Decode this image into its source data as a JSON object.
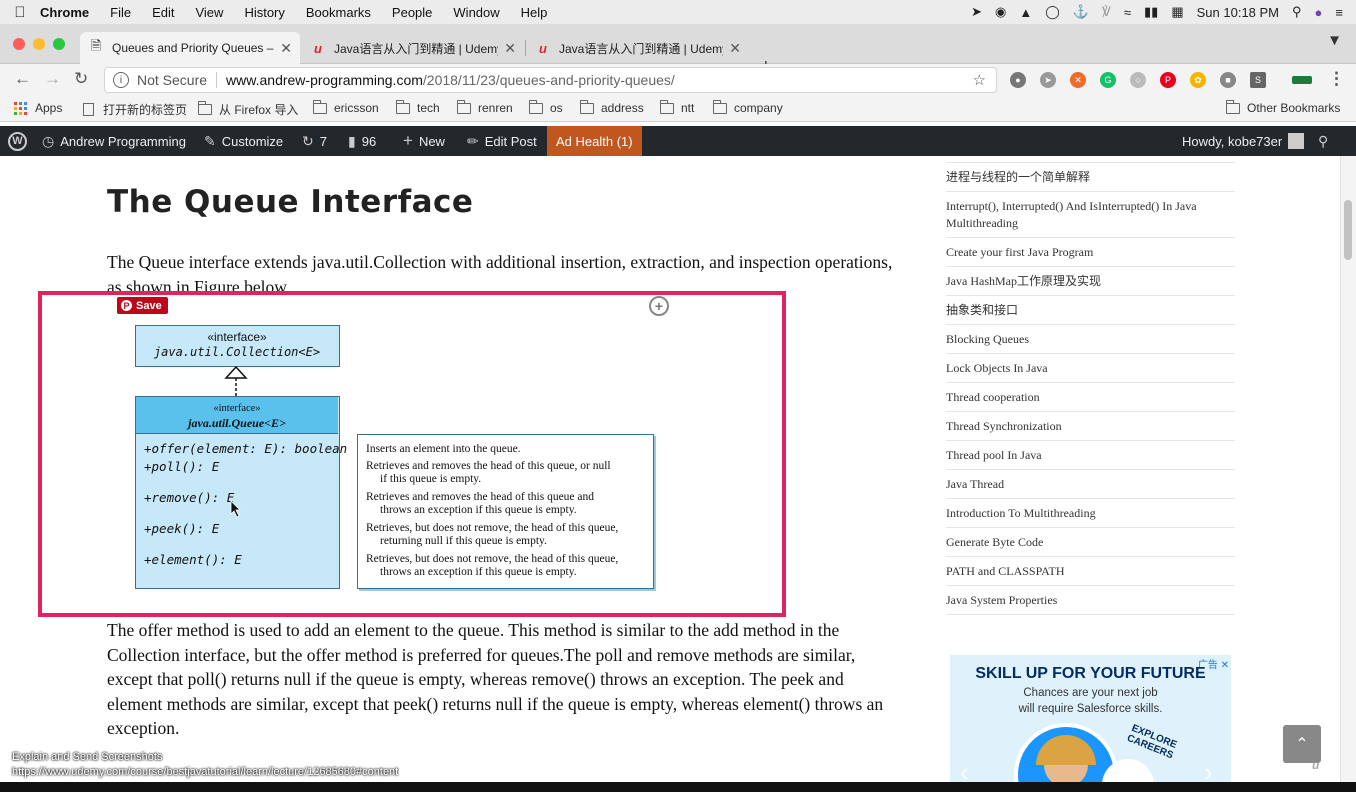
{
  "menubar": {
    "app_name": "Chrome",
    "items": [
      "File",
      "Edit",
      "View",
      "History",
      "Bookmarks",
      "People",
      "Window",
      "Help"
    ],
    "clock": "Sun 10:18 PM"
  },
  "tabs": [
    {
      "title": "Queues and Priority Queues – A",
      "icon": "page-icon"
    },
    {
      "title": "Java语言从入门到精通 | Udemy",
      "icon": "udemy-icon"
    },
    {
      "title": "Java语言从入门到精通 | Udemy",
      "icon": "udemy-icon"
    }
  ],
  "toolbar": {
    "security_label": "Not Secure",
    "url_host": "www.andrew-programming.com",
    "url_path": "/2018/11/23/queues-and-priority-queues/"
  },
  "bookmarks": {
    "apps": "Apps",
    "items": [
      "打开新的标签页",
      "从 Firefox 导入",
      "ericsson",
      "tech",
      "renren",
      "os",
      "address",
      "ntt",
      "company"
    ],
    "other": "Other Bookmarks"
  },
  "adminbar": {
    "site": "Andrew Programming",
    "customize": "Customize",
    "updates": "7",
    "comments": "96",
    "new": "New",
    "edit_post": "Edit Post",
    "ad_health": "Ad Health (1)",
    "howdy": "Howdy, kobe73er"
  },
  "article": {
    "title": "The Queue Interface",
    "intro": "The Queue interface extends java.util.Collection with additional insertion, extraction, and inspection operations, as shown in Figure below.",
    "body": "The offer method is used to add an element to the queue. This method is similar to the add method in the Collection interface, but the offer method is preferred for queues.The poll and remove methods are similar, except that poll() returns null if the queue is empty, whereas remove() throws an exception. The peek and element methods are similar, except that peek() returns null if the queue is empty, whereas element() throws an exception.",
    "pin_save": "Save"
  },
  "diagram": {
    "collection_stereotype": "«interface»",
    "collection_name": "java.util.Collection<E>",
    "queue_stereotype": "«interface»",
    "queue_name": "java.util.Queue<E>",
    "methods": [
      "+offer(element: E): boolean",
      "+poll(): E",
      "+remove(): E",
      "+peek(): E",
      "+element(): E"
    ],
    "descriptions": [
      {
        "line1": "Inserts an element into the queue.",
        "line2": ""
      },
      {
        "line1": "Retrieves and removes the head of this queue, or null",
        "line2": "if this queue is empty."
      },
      {
        "line1": "Retrieves and removes the head of this queue and",
        "line2": "throws an exception if this queue is empty."
      },
      {
        "line1": "Retrieves, but does not remove, the head of this queue,",
        "line2": "returning null if this queue is empty."
      },
      {
        "line1": "Retrieves, but does not remove, the head of this queue,",
        "line2": "throws an exception if this queue is empty."
      }
    ]
  },
  "sidebar": {
    "items": [
      "进程与线程的一个简单解释",
      "Interrupt(), Interrupted() And IsInterrupted() In Java Multithreading",
      "Create your first Java Program",
      "Java HashMap工作原理及实现",
      "抽象类和接口",
      "Blocking Queues",
      "Lock Objects In Java",
      "Thread cooperation",
      "Thread Synchronization",
      "Thread pool In Java",
      "Java Thread",
      "Introduction To Multithreading",
      "Generate Byte Code",
      "PATH and CLASSPATH",
      "Java System Properties"
    ]
  },
  "ad": {
    "badge": "广告",
    "headline": "SKILL UP FOR YOUR FUTURE",
    "sub1": "Chances are your next job",
    "sub2": "will require Salesforce skills.",
    "badge_text": "EXPLORE CAREERS"
  },
  "overlay": {
    "line1": "Explain and Send Screenshots",
    "line2": "https://www.udemy.com/course/bestjavatutorial/learn/lecture/12685680#content"
  },
  "colors": {
    "admin_bar": "#23282d",
    "ad_health": "#c0571f",
    "highlight_border": "#e0245e",
    "uml_fill": "#c6e8f8",
    "uml_header": "#5ac0ec"
  }
}
